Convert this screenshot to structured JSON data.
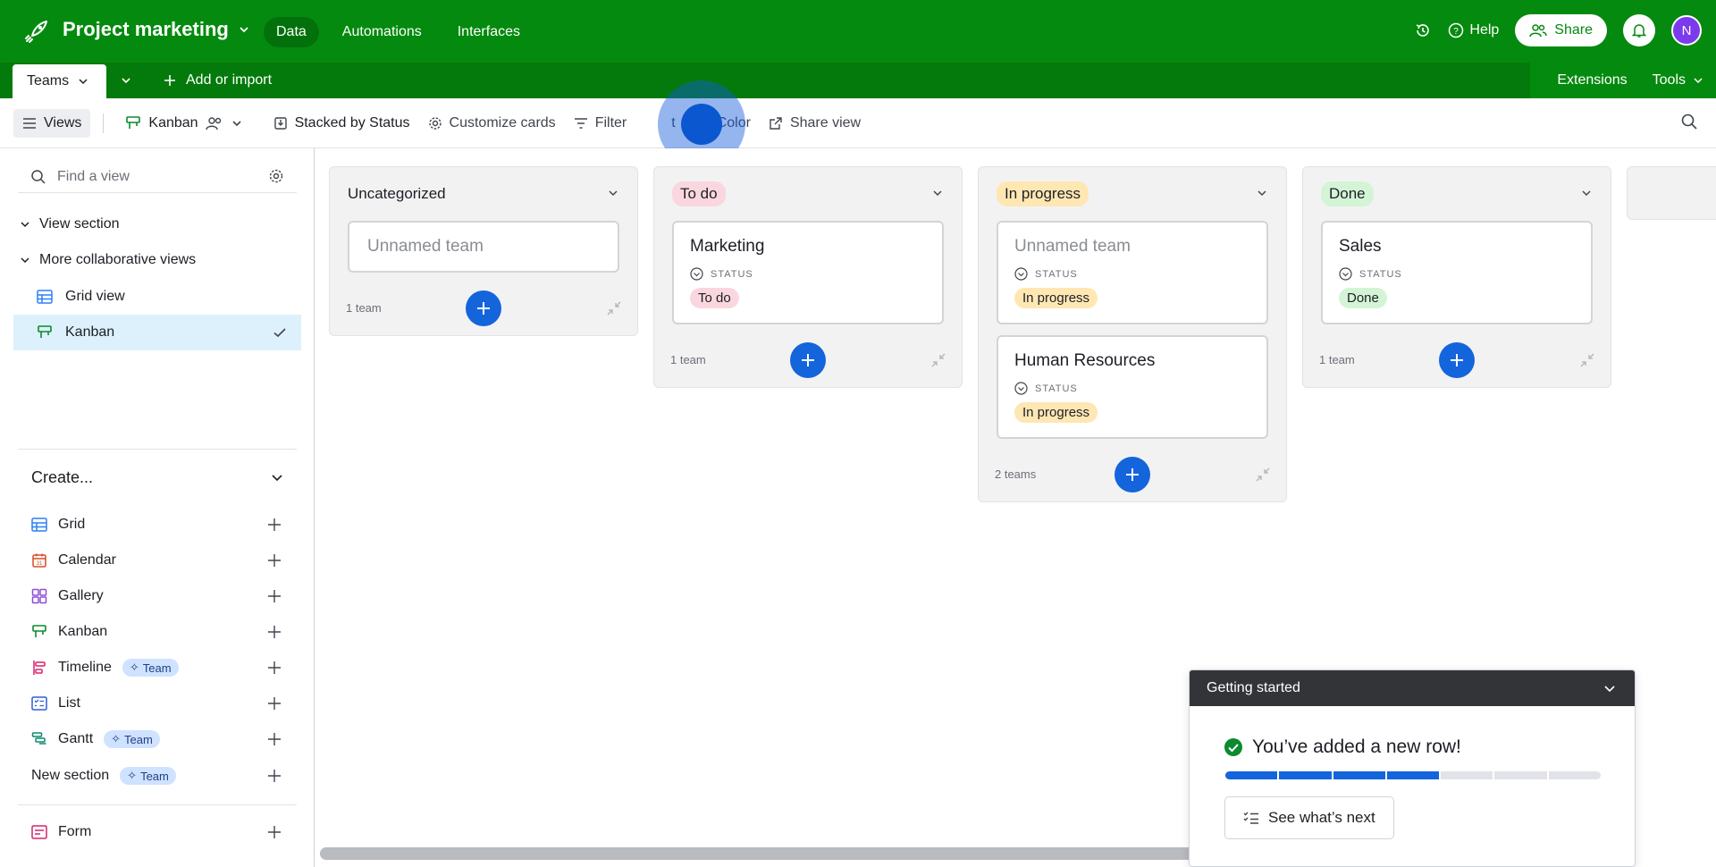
{
  "header": {
    "base_name": "Project marketing",
    "nav": [
      "Data",
      "Automations",
      "Interfaces"
    ],
    "help_label": "Help",
    "share_label": "Share",
    "avatar_initial": "N"
  },
  "tabbar": {
    "table_tab": "Teams",
    "add_import": "Add or import",
    "extensions": "Extensions",
    "tools": "Tools"
  },
  "viewbar": {
    "views": "Views",
    "view_name": "Kanban",
    "stacked_by": "Stacked by Status",
    "customize": "Customize cards",
    "filter": "Filter",
    "sort": "t",
    "color": "Color",
    "share_view": "Share view"
  },
  "sidebar": {
    "find_placeholder": "Find a view",
    "sections": [
      "View section",
      "More collaborative views"
    ],
    "views": [
      {
        "label": "Grid view",
        "icon": "grid-icon"
      },
      {
        "label": "Kanban",
        "icon": "kanban-icon",
        "active": true
      }
    ],
    "create_title": "Create...",
    "create_items": [
      {
        "label": "Grid",
        "icon": "grid-icon"
      },
      {
        "label": "Calendar",
        "icon": "calendar-icon"
      },
      {
        "label": "Gallery",
        "icon": "gallery-icon"
      },
      {
        "label": "Kanban",
        "icon": "kanban-icon"
      },
      {
        "label": "Timeline",
        "icon": "timeline-icon",
        "badge": "Team"
      },
      {
        "label": "List",
        "icon": "list-icon"
      },
      {
        "label": "Gantt",
        "icon": "gantt-icon",
        "badge": "Team"
      },
      {
        "label": "New section",
        "badge": "Team"
      },
      {
        "label": "Form",
        "icon": "form-icon"
      }
    ]
  },
  "board": {
    "field_label": "STATUS",
    "stacks": [
      {
        "title": "Uncategorized",
        "count": "1 team",
        "cards": [
          {
            "title": "Unnamed team",
            "empty": true
          }
        ]
      },
      {
        "title": "To do",
        "count": "1 team",
        "cards": [
          {
            "title": "Marketing",
            "status": "To do"
          }
        ]
      },
      {
        "title": "In progress",
        "count": "2 teams",
        "cards": [
          {
            "title": "Unnamed team",
            "status": "In progress",
            "placeholder": true
          },
          {
            "title": "Human Resources",
            "status": "In progress"
          }
        ]
      },
      {
        "title": "Done",
        "count": "1 team",
        "cards": [
          {
            "title": "Sales",
            "status": "Done"
          }
        ]
      }
    ]
  },
  "getting_started": {
    "title": "Getting started",
    "message": "You’ve added a new row!",
    "progress_filled": 4,
    "progress_total": 7,
    "next_label": "See what’s next"
  },
  "colors": {
    "header_green": "#048a0e",
    "accent_blue": "#1464dc",
    "todo": "#fad7de",
    "in_progress": "#ffe7b3",
    "done": "#d4f4d6"
  }
}
